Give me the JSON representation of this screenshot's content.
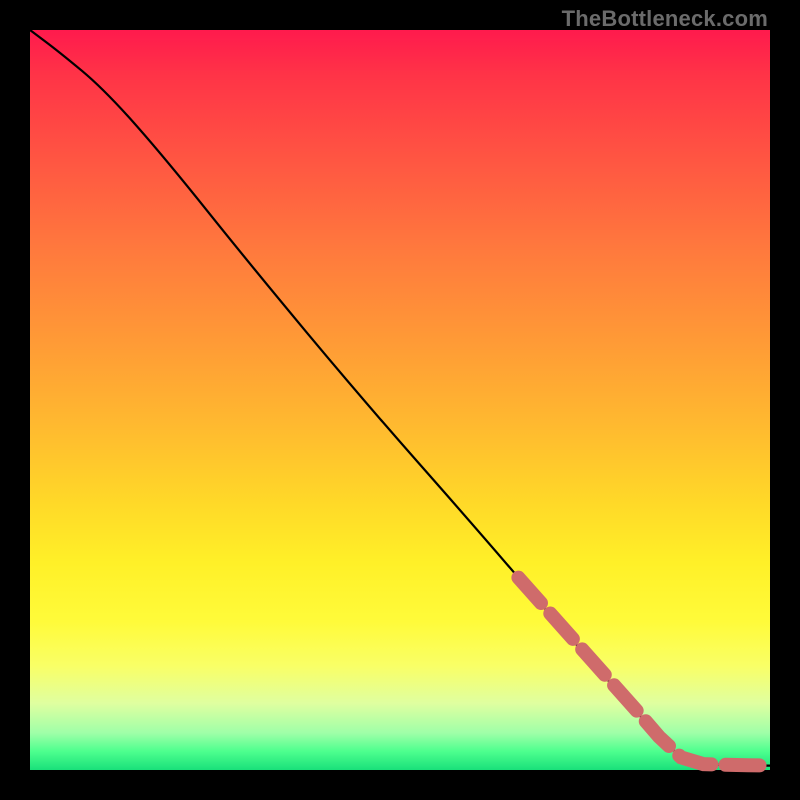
{
  "watermark": "TheBottleneck.com",
  "chart_data": {
    "type": "line",
    "title": "",
    "xlabel": "",
    "ylabel": "",
    "xlim": [
      0,
      100
    ],
    "ylim": [
      0,
      100
    ],
    "grid": false,
    "series": [
      {
        "name": "curve",
        "style": "solid-black",
        "points": [
          {
            "x": 0,
            "y": 100
          },
          {
            "x": 4,
            "y": 97
          },
          {
            "x": 10,
            "y": 92
          },
          {
            "x": 18,
            "y": 83
          },
          {
            "x": 30,
            "y": 68
          },
          {
            "x": 45,
            "y": 50
          },
          {
            "x": 60,
            "y": 33
          },
          {
            "x": 72,
            "y": 19
          },
          {
            "x": 80,
            "y": 10
          },
          {
            "x": 85,
            "y": 4.5
          },
          {
            "x": 88,
            "y": 1.7
          },
          {
            "x": 90,
            "y": 0.9
          },
          {
            "x": 93,
            "y": 0.7
          },
          {
            "x": 96,
            "y": 0.6
          },
          {
            "x": 100,
            "y": 0.6
          }
        ]
      },
      {
        "name": "highlight-segment",
        "style": "thick-dashed-salmon",
        "color": "#cf6b6b",
        "points": [
          {
            "x": 66,
            "y": 26
          },
          {
            "x": 70,
            "y": 21.5
          },
          {
            "x": 74,
            "y": 17
          },
          {
            "x": 78,
            "y": 12.5
          },
          {
            "x": 82,
            "y": 8
          },
          {
            "x": 85,
            "y": 4.5
          },
          {
            "x": 88,
            "y": 1.7
          },
          {
            "x": 91,
            "y": 0.8
          },
          {
            "x": 94,
            "y": 0.7
          },
          {
            "x": 97,
            "y": 0.65
          },
          {
            "x": 100,
            "y": 0.6
          }
        ]
      }
    ]
  }
}
